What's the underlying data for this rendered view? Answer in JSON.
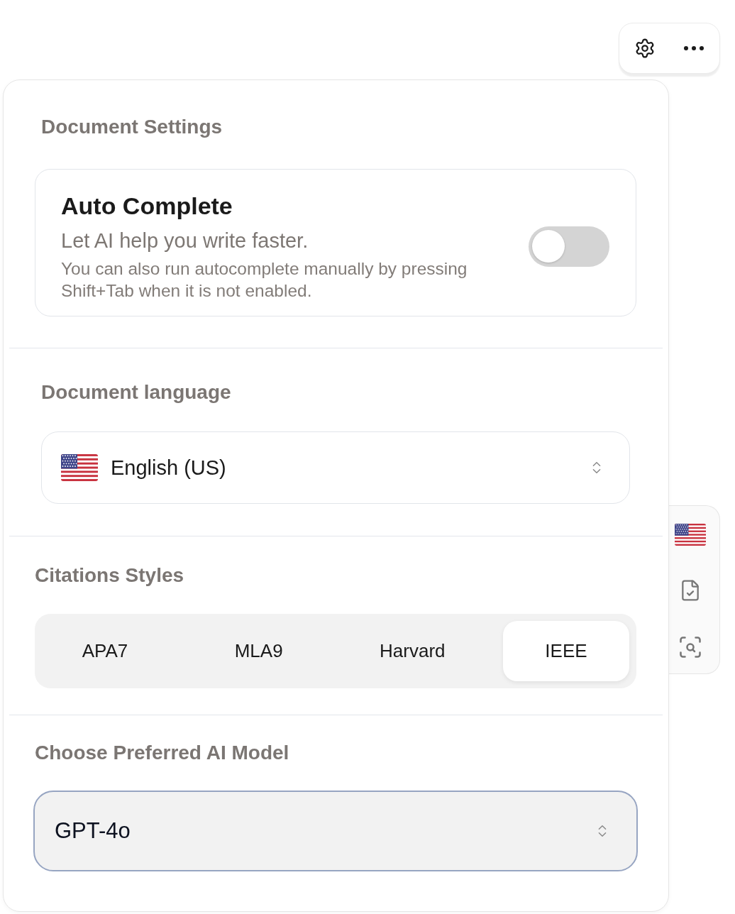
{
  "panel": {
    "title": "Document Settings"
  },
  "auto_complete": {
    "title": "Auto Complete",
    "subtitle": "Let AI help you write faster.",
    "description": "You can also run autocomplete manually by pressing Shift+Tab when it is not enabled.",
    "on": false
  },
  "language": {
    "heading": "Document language",
    "value": "English (US)"
  },
  "citations": {
    "heading": "Citations Styles",
    "styles": [
      {
        "label": "APA7",
        "selected": false
      },
      {
        "label": "MLA9",
        "selected": false
      },
      {
        "label": "Harvard",
        "selected": false
      },
      {
        "label": "IEEE",
        "selected": true
      }
    ]
  },
  "model": {
    "heading": "Choose Preferred AI Model",
    "value": "GPT-4o",
    "focused": true
  }
}
